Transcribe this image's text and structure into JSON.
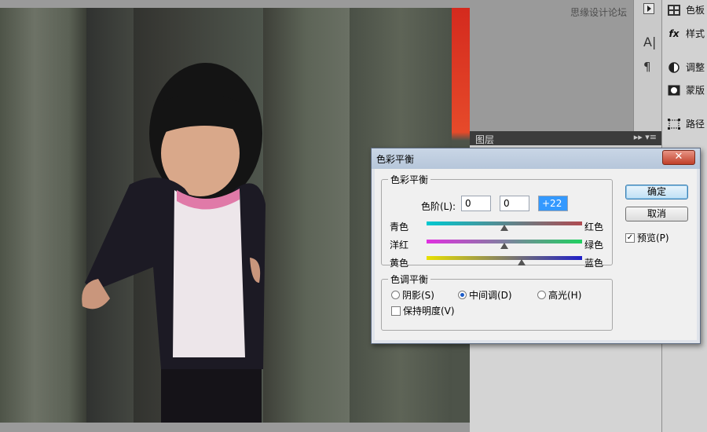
{
  "watermark": "思缘设计论坛",
  "right_panel": {
    "items": [
      {
        "label": "色板",
        "icon": "swatches-icon"
      },
      {
        "label": "样式",
        "icon": "fx-icon"
      },
      {
        "label": "调整",
        "icon": "adjustments-icon"
      },
      {
        "label": "蒙版",
        "icon": "mask-icon"
      },
      {
        "label": "路径",
        "icon": "paths-icon"
      }
    ],
    "strip_icons": [
      "play-icon",
      "character-icon",
      "paragraph-icon"
    ]
  },
  "layers_panel": {
    "tab_label": "图层",
    "controls": "▸▸ ▾≡"
  },
  "dialog": {
    "title": "色彩平衡",
    "close_symbol": "✕",
    "color_balance": {
      "group_label": "色彩平衡",
      "levels_label": "色阶(L):",
      "levels_values": [
        "0",
        "0",
        "+22"
      ],
      "sliders": [
        {
          "left": "青色",
          "right": "红色",
          "value": 0
        },
        {
          "left": "洋红",
          "right": "绿色",
          "value": 0
        },
        {
          "left": "黄色",
          "right": "蓝色",
          "value": 22
        }
      ]
    },
    "tone_balance": {
      "group_label": "色调平衡",
      "options": [
        "阴影(S)",
        "中间调(D)",
        "高光(H)"
      ],
      "selected": "中间调(D)",
      "preserve_luminosity": "保持明度(V)",
      "preserve_checked": false
    },
    "buttons": {
      "ok": "确定",
      "cancel": "取消"
    },
    "preview": {
      "label": "预览(P)",
      "checked": true
    }
  }
}
